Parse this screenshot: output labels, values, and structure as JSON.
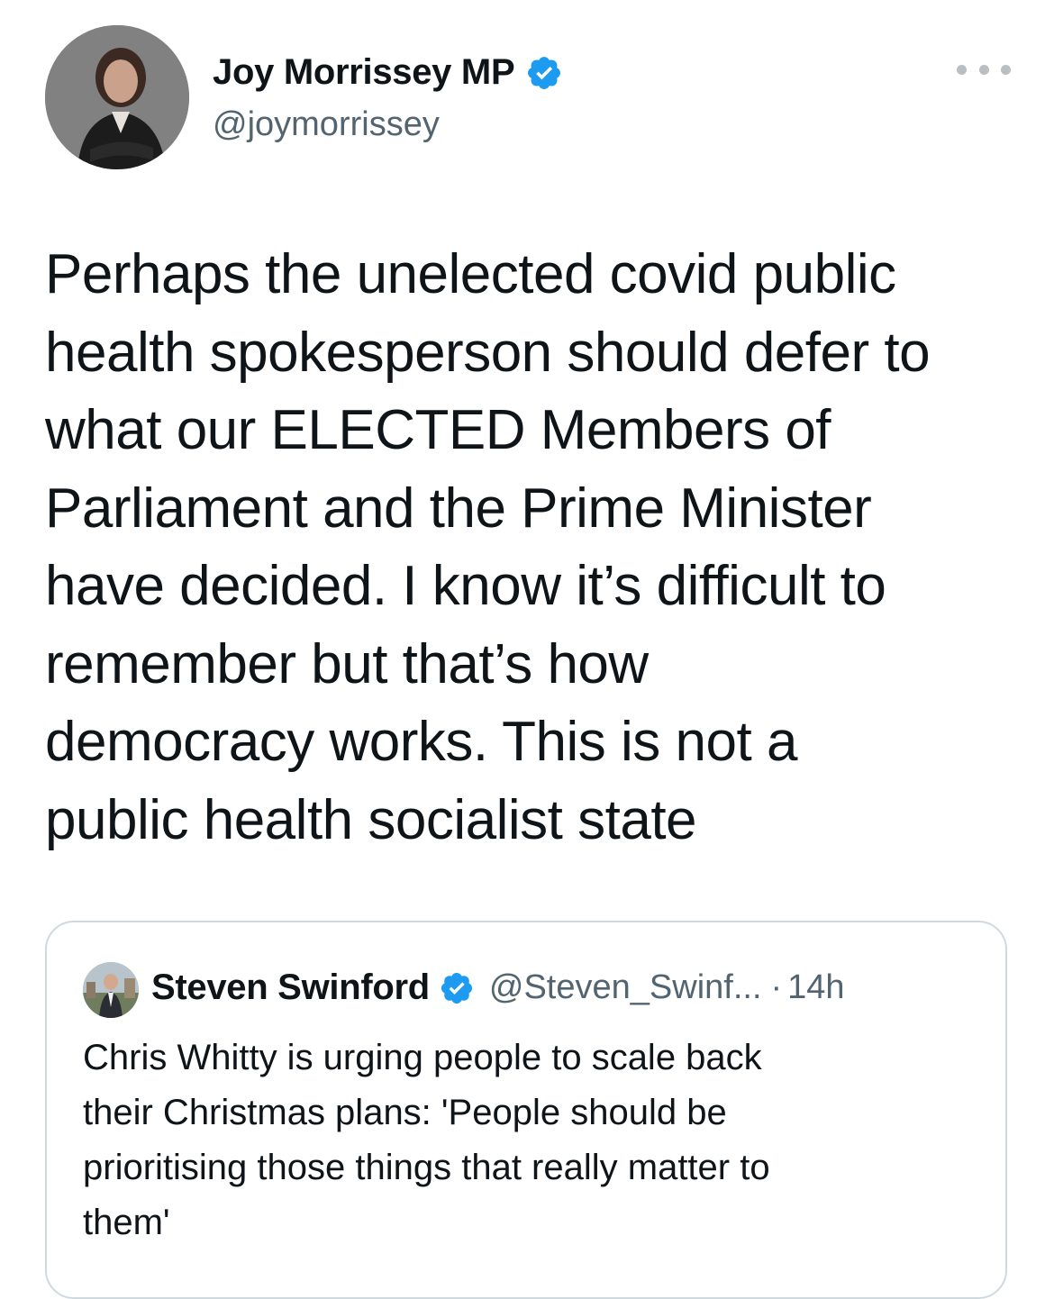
{
  "tweet": {
    "author": {
      "name": "Joy Morrissey MP",
      "handle": "@joymorrissey",
      "verified": true,
      "avatar_icon": "profile-photo"
    },
    "more_icon": "more-horizontal-icon",
    "text": "Perhaps the unelected covid public\nhealth spokesperson should defer to\nwhat our ELECTED Members of\nParliament and the Prime Minister\nhave decided. I know it’s difficult to\nremember but that’s how\ndemocracy works. This is not a\npublic health socialist state"
  },
  "quote": {
    "author": {
      "name": "Steven Swinford",
      "handle": "@Steven_Swinf...",
      "verified": true,
      "avatar_icon": "profile-photo"
    },
    "separator": "·",
    "time": "14h",
    "text": "Chris Whitty is urging people to scale back\ntheir Christmas plans: 'People should be\nprioritising those things that really matter to\nthem'"
  },
  "colors": {
    "verified_blue": "#1d9bf0",
    "secondary_text": "#536471",
    "border": "#cfd9de",
    "primary_text": "#0f1419"
  }
}
